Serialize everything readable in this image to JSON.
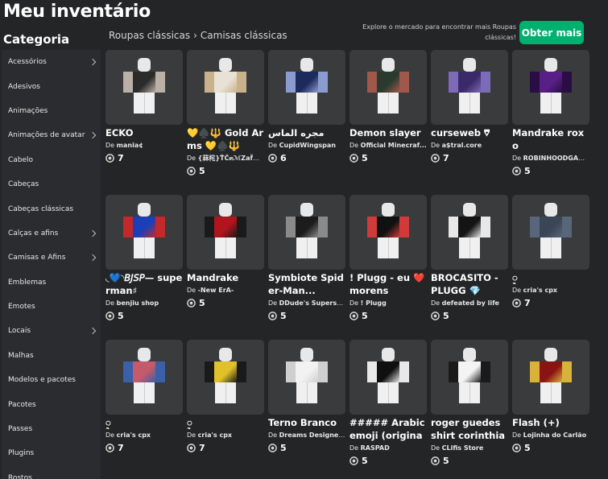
{
  "header": {
    "title": "Meu inventário",
    "category_title": "Categoria",
    "breadcrumb": [
      "Roupas clássicas",
      "Camisas clássicas"
    ],
    "promo_text": "Explore o mercado para encontrar mais Roupas clássicas!",
    "buy_button": "Obter mais"
  },
  "sidebar": {
    "items": [
      {
        "label": "Acessórios",
        "chevron": true
      },
      {
        "label": "Adesivos",
        "chevron": false
      },
      {
        "label": "Animações",
        "chevron": false
      },
      {
        "label": "Animações de avatar",
        "chevron": true
      },
      {
        "label": "Cabelo",
        "chevron": false
      },
      {
        "label": "Cabeças",
        "chevron": false
      },
      {
        "label": "Cabeças clássicas",
        "chevron": false
      },
      {
        "label": "Calças e afins",
        "chevron": true
      },
      {
        "label": "Camisas e Afins",
        "chevron": true
      },
      {
        "label": "Emblemas",
        "chevron": false
      },
      {
        "label": "Emotes",
        "chevron": false
      },
      {
        "label": "Locais",
        "chevron": true
      },
      {
        "label": "Malhas",
        "chevron": false
      },
      {
        "label": "Modelos e pacotes",
        "chevron": false
      },
      {
        "label": "Pacotes",
        "chevron": false
      },
      {
        "label": "Passes",
        "chevron": false
      },
      {
        "label": "Plugins",
        "chevron": false
      },
      {
        "label": "Rostos",
        "chevron": false
      }
    ]
  },
  "creator_prefix": "De",
  "items": [
    {
      "name": "ECKO",
      "creator": "mania¢",
      "price": "7",
      "colors": [
        "#2b2b2b",
        "#b9b0a6"
      ]
    },
    {
      "name": "💛♠️🔱 Gold Arms 💛♠️🔱",
      "creator": "{菻㭦}ŤČ๓ℳZaf̈K̈i...",
      "price": "5",
      "colors": [
        "#e8e2d6",
        "#c9b28a"
      ]
    },
    {
      "name": "مجره الماس",
      "creator": "CupidWingspan",
      "price": "6",
      "colors": [
        "#1d2a5c",
        "#8a9bd0"
      ]
    },
    {
      "name": "Demon slayer",
      "creator": "Official Minecraf...",
      "price": "5",
      "colors": [
        "#2b3a2f",
        "#a0584a"
      ]
    },
    {
      "name": "curseweb ⩢",
      "creator": "a$tral.core",
      "price": "7",
      "colors": [
        "#3b2a6a",
        "#7d6ab8"
      ]
    },
    {
      "name": "Mandrake roxo",
      "creator": "ROBINHOODGAM...",
      "price": "5",
      "colors": [
        "#5a1f86",
        "#2a0d44"
      ]
    },
    {
      "name": "◟💙◝𝘉𝘑𝘚𝘗— superman♯",
      "creator": "benjiu shop",
      "price": "5",
      "colors": [
        "#1c3fb8",
        "#c3282a"
      ]
    },
    {
      "name": "Mandrake",
      "creator": "-New ErA-",
      "price": "5",
      "colors": [
        "#b0141d",
        "#1a1a1a"
      ]
    },
    {
      "name": "Symbiote Spider-Man...",
      "creator": "DDude's Supersui...",
      "price": "5",
      "colors": [
        "#1c1c1c",
        "#8a8a8a"
      ]
    },
    {
      "name": "! Plugg - eu ❤️ morens",
      "creator": "! Plugg",
      "price": "5",
      "colors": [
        "#111111",
        "#d23a3a"
      ]
    },
    {
      "name": "BROCASITO - PLUGG 💎",
      "creator": "defeated by life",
      "price": "5",
      "colors": [
        "#141414",
        "#e8e8e8"
      ]
    },
    {
      "name": "ᢩ",
      "creator": "cria's cpx",
      "price": "7",
      "colors": [
        "#3a4656",
        "#58667a"
      ]
    },
    {
      "name": "ᢩ",
      "creator": "cria's cpx",
      "price": "7",
      "colors": [
        "#c55a6a",
        "#3b5fa8"
      ]
    },
    {
      "name": "ᢩ",
      "creator": "cria's cpx",
      "price": "7",
      "colors": [
        "#e0c12a",
        "#1a1a1a"
      ]
    },
    {
      "name": "Terno Branco",
      "creator": "Dreams Designers",
      "price": "5",
      "colors": [
        "#f2f2f2",
        "#cfcfcf"
      ]
    },
    {
      "name": "##### Arabic emoji (original...",
      "creator": "RASPAD",
      "price": "5",
      "colors": [
        "#0f0f0f",
        "#e8e8e8"
      ]
    },
    {
      "name": "roger guedes shirt corinthians",
      "creator": "CLifis Store",
      "price": "5",
      "colors": [
        "#f4f4f4",
        "#1a1a1a"
      ]
    },
    {
      "name": "Flash (+)",
      "creator": "Lojinha do Carlão",
      "price": "5",
      "colors": [
        "#8a1414",
        "#d9b23a"
      ]
    }
  ]
}
